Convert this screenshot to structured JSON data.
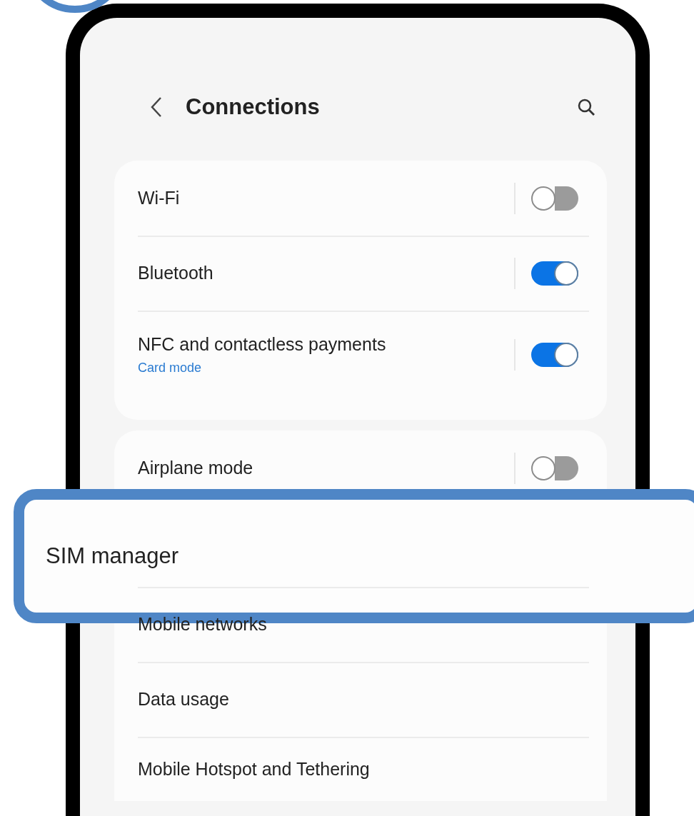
{
  "header": {
    "title": "Connections"
  },
  "groups": [
    {
      "items": [
        {
          "kind": "toggle",
          "label": "Wi-Fi",
          "on": false
        },
        {
          "kind": "toggle",
          "label": "Bluetooth",
          "on": true
        },
        {
          "kind": "toggle",
          "label": "NFC and contactless payments",
          "subtitle": "Card mode",
          "on": true
        }
      ]
    },
    {
      "items": [
        {
          "kind": "toggle",
          "label": "Airplane mode",
          "on": false
        },
        {
          "kind": "highlight",
          "label": "SIM manager"
        },
        {
          "kind": "link",
          "label": "Mobile networks"
        },
        {
          "kind": "link",
          "label": "Data usage"
        },
        {
          "kind": "link",
          "label": "Mobile Hotspot and Tethering"
        }
      ]
    }
  ]
}
